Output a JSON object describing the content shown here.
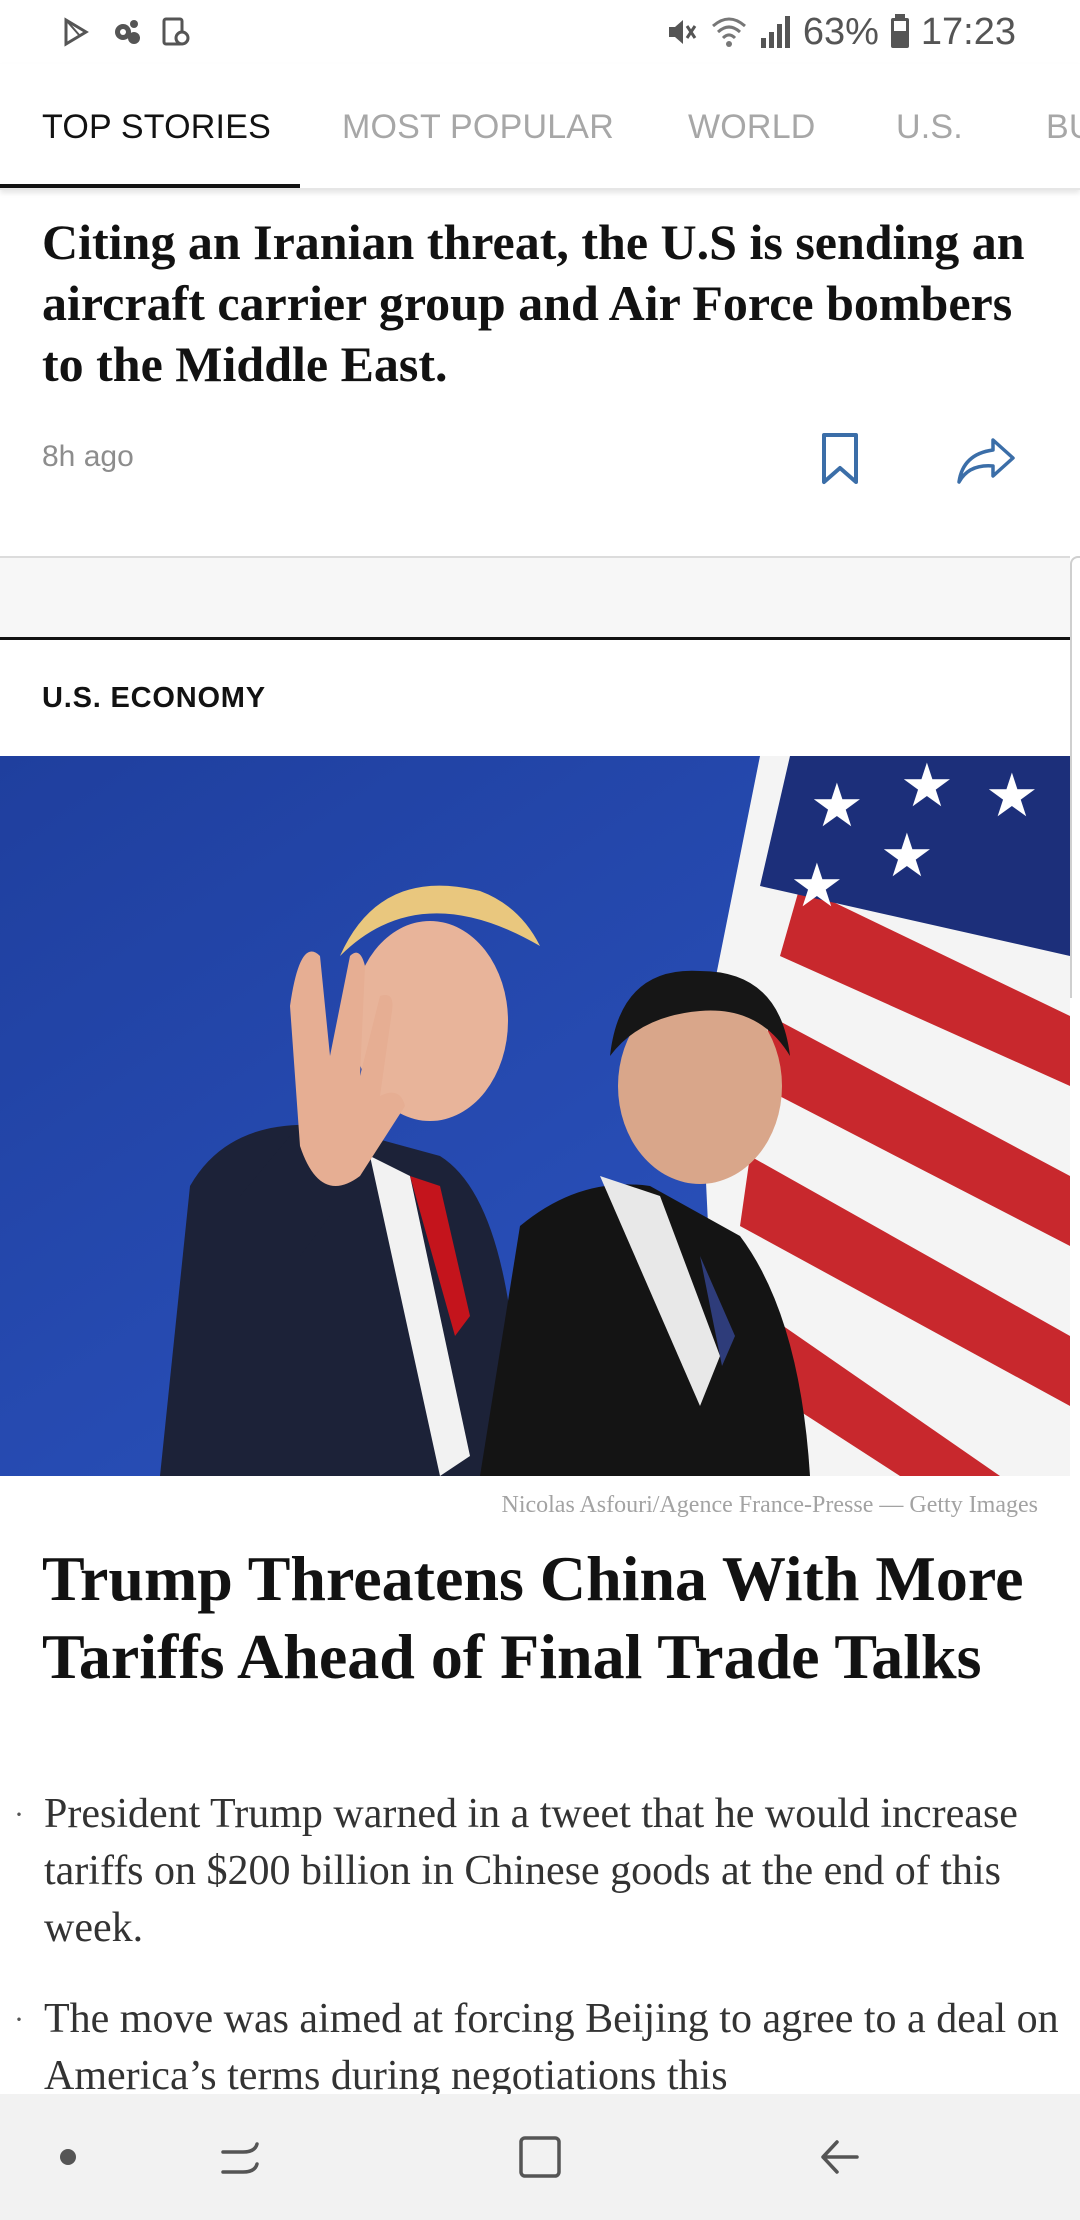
{
  "status_bar": {
    "left_icons": [
      "play-store-icon",
      "settings-notification-icon",
      "screenshot-icon"
    ],
    "right_icons": [
      "mute-icon",
      "wifi-icon",
      "signal-icon",
      "battery-icon"
    ],
    "battery": "63%",
    "time": "17:23"
  },
  "tabs": [
    {
      "label": "TOP STORIES",
      "active": true
    },
    {
      "label": "MOST POPULAR",
      "active": false
    },
    {
      "label": "WORLD",
      "active": false
    },
    {
      "label": "U.S.",
      "active": false
    },
    {
      "label": "BU",
      "active": false
    }
  ],
  "story1": {
    "headline": "Citing an Iranian threat, the U.S is sending an aircraft carrier group and Air Force bombers to the Middle East.",
    "time_ago": "8h ago",
    "bookmark_icon": "bookmark-icon",
    "share_icon": "share-icon"
  },
  "story2": {
    "section": "U.S. ECONOMY",
    "image_caption": "Nicolas Asfouri/Agence France-Presse — Getty Images",
    "headline": "Trump Threatens China With More Tariffs Ahead of Final Trade Talks",
    "bullets": [
      "President Trump warned in a tweet that he would increase tariffs on $200 billion in Chinese goods at the end of this week.",
      "The move was aimed at forcing Beijing to agree to a deal on America’s terms during negotiations this"
    ]
  },
  "nav_bar": {
    "items": [
      "dot-icon",
      "recent-apps-icon",
      "home-icon",
      "back-icon"
    ]
  },
  "colors": {
    "text": "#121212",
    "muted": "#a7a7a7",
    "share_blue": "#3b6ea8",
    "photo_bg_blue": "#2446a8"
  }
}
